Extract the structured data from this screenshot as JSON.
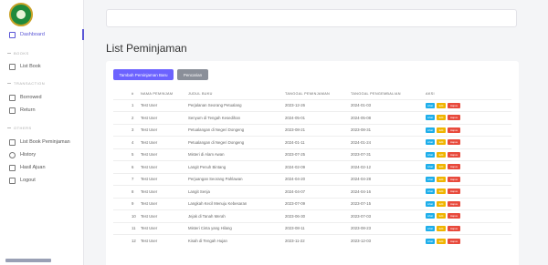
{
  "sidebar": {
    "items": [
      {
        "label": "Dashboard",
        "section": ""
      },
      {
        "label": "List Book",
        "section": "BOOKS"
      },
      {
        "label": "Borrowed",
        "section": "TRANSACTION"
      },
      {
        "label": "Return",
        "section": ""
      },
      {
        "label": "List Book Peminjaman",
        "section": "OTHERS"
      },
      {
        "label": "History",
        "section": ""
      },
      {
        "label": "Hasil Ajuan",
        "section": ""
      },
      {
        "label": "Logout",
        "section": ""
      }
    ],
    "sections": [
      "BOOKS",
      "TRANSACTION",
      "OTHERS"
    ]
  },
  "page": {
    "title": "List Peminjaman"
  },
  "toolbar": {
    "add_label": "Tambah Peminjaman Baru",
    "search_label": "Pencarian"
  },
  "table": {
    "headers": [
      "#",
      "NAMA PEMINJAM",
      "JUDUL BUKU",
      "TANGGAL PEMINJAMAN",
      "TANGGAL PENGEMBALIAN",
      "AKSI"
    ],
    "action_labels": {
      "view": "Lihat",
      "edit": "Edit",
      "delete": "Hapus"
    },
    "rows": [
      {
        "no": "1",
        "name": "Test User",
        "book": "Perjalanan Seorang Petualang",
        "pinjam": "2023-12-26",
        "kembali": "2024-01-03"
      },
      {
        "no": "2",
        "name": "Test User",
        "book": "Senyum di Tengah Kesedihan",
        "pinjam": "2024-05-01",
        "kembali": "2024-05-08"
      },
      {
        "no": "3",
        "name": "Test User",
        "book": "Petualangan di Negeri Dongeng",
        "pinjam": "2023-08-21",
        "kembali": "2023-08-31"
      },
      {
        "no": "4",
        "name": "Test User",
        "book": "Petualangan di Negeri Dongeng",
        "pinjam": "2024-01-11",
        "kembali": "2024-01-24"
      },
      {
        "no": "5",
        "name": "Test User",
        "book": "Misteri di Alam Awan",
        "pinjam": "2023-07-25",
        "kembali": "2023-07-31"
      },
      {
        "no": "6",
        "name": "Test User",
        "book": "Langit Penuh Bintang",
        "pinjam": "2024-02-09",
        "kembali": "2024-02-12"
      },
      {
        "no": "7",
        "name": "Test User",
        "book": "Perjuangan Seorang Pahlawan",
        "pinjam": "2024-04-20",
        "kembali": "2024-04-28"
      },
      {
        "no": "8",
        "name": "Test User",
        "book": "Langit Senja",
        "pinjam": "2024-04-07",
        "kembali": "2024-04-16"
      },
      {
        "no": "9",
        "name": "Test User",
        "book": "Langkah Kecil Menuju Kebesaran",
        "pinjam": "2023-07-09",
        "kembali": "2023-07-15"
      },
      {
        "no": "10",
        "name": "Test User",
        "book": "Jejak di Tanah Merah",
        "pinjam": "2023-06-30",
        "kembali": "2023-07-03"
      },
      {
        "no": "11",
        "name": "Test User",
        "book": "Misteri Cinta yang Hilang",
        "pinjam": "2023-08-11",
        "kembali": "2023-08-23"
      },
      {
        "no": "12",
        "name": "Test User",
        "book": "Kisah di Tengah Hujan",
        "pinjam": "2023-11-22",
        "kembali": "2023-12-03"
      }
    ]
  }
}
